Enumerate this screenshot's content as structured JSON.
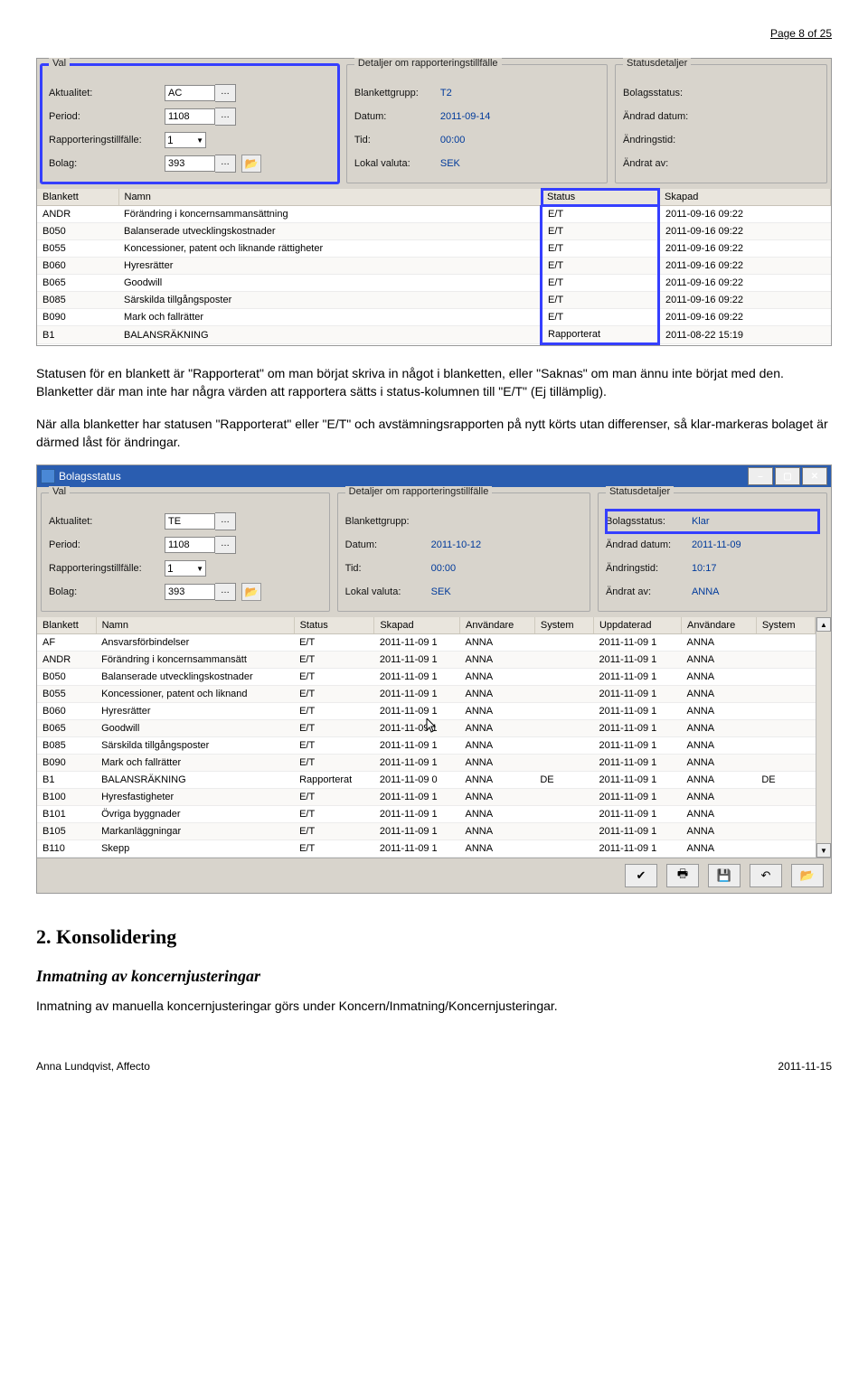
{
  "page_header": "Page 8 of 25",
  "para1": "Statusen för en blankett är \"Rapporterat\" om man börjat skriva in något i blanketten, eller \"Saknas\" om man ännu inte börjat med den. Blanketter där man inte har några värden att rapportera sätts i status-kolumnen till \"E/T\" (Ej tillämplig).",
  "para2": "När alla blanketter har statusen \"Rapporterat\" eller \"E/T\" och avstämningsrapporten på nytt körts utan differenser, så klar-markeras bolaget är därmed låst för ändringar.",
  "app1": {
    "val": {
      "legend": "Val",
      "aktualitet_label": "Aktualitet:",
      "aktualitet_value": "AC",
      "period_label": "Period:",
      "period_value": "1108",
      "rapp_label": "Rapporteringstillfälle:",
      "rapp_value": "1",
      "bolag_label": "Bolag:",
      "bolag_value": "393"
    },
    "details": {
      "legend": "Detaljer om rapporteringstillfälle",
      "grupp_label": "Blankettgrupp:",
      "grupp_value": "T2",
      "datum_label": "Datum:",
      "datum_value": "2011-09-14",
      "tid_label": "Tid:",
      "tid_value": "00:00",
      "valuta_label": "Lokal valuta:",
      "valuta_value": "SEK"
    },
    "status": {
      "legend": "Statusdetaljer",
      "bolag_label": "Bolagsstatus:",
      "and_datum_label": "Ändrad datum:",
      "and_tid_label": "Ändringstid:",
      "and_av_label": "Ändrat av:"
    },
    "cols": {
      "c1": "Blankett",
      "c2": "Namn",
      "c3": "Status",
      "c4": "Skapad"
    },
    "rows": [
      {
        "c1": "ANDR",
        "c2": "Förändring i koncernsammansättning",
        "c3": "E/T",
        "c4": "2011-09-16 09:22"
      },
      {
        "c1": "B050",
        "c2": "Balanserade utvecklingskostnader",
        "c3": "E/T",
        "c4": "2011-09-16 09:22"
      },
      {
        "c1": "B055",
        "c2": "Koncessioner, patent och liknande rättigheter",
        "c3": "E/T",
        "c4": "2011-09-16 09:22"
      },
      {
        "c1": "B060",
        "c2": "Hyresrätter",
        "c3": "E/T",
        "c4": "2011-09-16 09:22"
      },
      {
        "c1": "B065",
        "c2": "Goodwill",
        "c3": "E/T",
        "c4": "2011-09-16 09:22"
      },
      {
        "c1": "B085",
        "c2": "Särskilda tillgångsposter",
        "c3": "E/T",
        "c4": "2011-09-16 09:22"
      },
      {
        "c1": "B090",
        "c2": "Mark och fallrätter",
        "c3": "E/T",
        "c4": "2011-09-16 09:22"
      },
      {
        "c1": "B1",
        "c2": "BALANSRÄKNING",
        "c3": "Rapporterat",
        "c4": "2011-08-22 15:19"
      }
    ]
  },
  "app2": {
    "title": "Bolagsstatus",
    "val": {
      "legend": "Val",
      "aktualitet_label": "Aktualitet:",
      "aktualitet_value": "TE",
      "period_label": "Period:",
      "period_value": "1108",
      "rapp_label": "Rapporteringstillfälle:",
      "rapp_value": "1",
      "bolag_label": "Bolag:",
      "bolag_value": "393"
    },
    "details": {
      "legend": "Detaljer om rapporteringstillfälle",
      "grupp_label": "Blankettgrupp:",
      "grupp_value": "",
      "datum_label": "Datum:",
      "datum_value": "2011-10-12",
      "tid_label": "Tid:",
      "tid_value": "00:00",
      "valuta_label": "Lokal valuta:",
      "valuta_value": "SEK"
    },
    "status": {
      "legend": "Statusdetaljer",
      "bolag_label": "Bolagsstatus:",
      "bolag_value": "Klar",
      "and_datum_label": "Ändrad datum:",
      "and_datum_value": "2011-11-09",
      "and_tid_label": "Ändringstid:",
      "and_tid_value": "10:17",
      "and_av_label": "Ändrat av:",
      "and_av_value": "ANNA"
    },
    "cols": {
      "c1": "Blankett",
      "c2": "Namn",
      "c3": "Status",
      "c4": "Skapad",
      "c5": "Användare",
      "c6": "System",
      "c7": "Uppdaterad",
      "c8": "Användare",
      "c9": "System"
    },
    "rows": [
      {
        "c1": "AF",
        "c2": "Ansvarsförbindelser",
        "c3": "E/T",
        "c4": "2011-11-09 1",
        "c5": "ANNA",
        "c6": "",
        "c7": "2011-11-09 1",
        "c8": "ANNA",
        "c9": ""
      },
      {
        "c1": "ANDR",
        "c2": "Förändring i koncernsammansätt",
        "c3": "E/T",
        "c4": "2011-11-09 1",
        "c5": "ANNA",
        "c6": "",
        "c7": "2011-11-09 1",
        "c8": "ANNA",
        "c9": ""
      },
      {
        "c1": "B050",
        "c2": "Balanserade utvecklingskostnader",
        "c3": "E/T",
        "c4": "2011-11-09 1",
        "c5": "ANNA",
        "c6": "",
        "c7": "2011-11-09 1",
        "c8": "ANNA",
        "c9": ""
      },
      {
        "c1": "B055",
        "c2": "Koncessioner, patent och liknand",
        "c3": "E/T",
        "c4": "2011-11-09 1",
        "c5": "ANNA",
        "c6": "",
        "c7": "2011-11-09 1",
        "c8": "ANNA",
        "c9": ""
      },
      {
        "c1": "B060",
        "c2": "Hyresrätter",
        "c3": "E/T",
        "c4": "2011-11-09 1",
        "c5": "ANNA",
        "c6": "",
        "c7": "2011-11-09 1",
        "c8": "ANNA",
        "c9": ""
      },
      {
        "c1": "B065",
        "c2": "Goodwill",
        "c3": "E/T",
        "c4": "2011-11-09 1",
        "c5": "ANNA",
        "c6": "",
        "c7": "2011-11-09 1",
        "c8": "ANNA",
        "c9": ""
      },
      {
        "c1": "B085",
        "c2": "Särskilda tillgångsposter",
        "c3": "E/T",
        "c4": "2011-11-09 1",
        "c5": "ANNA",
        "c6": "",
        "c7": "2011-11-09 1",
        "c8": "ANNA",
        "c9": ""
      },
      {
        "c1": "B090",
        "c2": "Mark och fallrätter",
        "c3": "E/T",
        "c4": "2011-11-09 1",
        "c5": "ANNA",
        "c6": "",
        "c7": "2011-11-09 1",
        "c8": "ANNA",
        "c9": ""
      },
      {
        "c1": "B1",
        "c2": "BALANSRÄKNING",
        "c3": "Rapporterat",
        "c4": "2011-11-09 0",
        "c5": "ANNA",
        "c6": "DE",
        "c7": "2011-11-09 1",
        "c8": "ANNA",
        "c9": "DE"
      },
      {
        "c1": "B100",
        "c2": "Hyresfastigheter",
        "c3": "E/T",
        "c4": "2011-11-09 1",
        "c5": "ANNA",
        "c6": "",
        "c7": "2011-11-09 1",
        "c8": "ANNA",
        "c9": ""
      },
      {
        "c1": "B101",
        "c2": "Övriga byggnader",
        "c3": "E/T",
        "c4": "2011-11-09 1",
        "c5": "ANNA",
        "c6": "",
        "c7": "2011-11-09 1",
        "c8": "ANNA",
        "c9": ""
      },
      {
        "c1": "B105",
        "c2": "Markanläggningar",
        "c3": "E/T",
        "c4": "2011-11-09 1",
        "c5": "ANNA",
        "c6": "",
        "c7": "2011-11-09 1",
        "c8": "ANNA",
        "c9": ""
      },
      {
        "c1": "B110",
        "c2": "Skepp",
        "c3": "E/T",
        "c4": "2011-11-09 1",
        "c5": "ANNA",
        "c6": "",
        "c7": "2011-11-09 1",
        "c8": "ANNA",
        "c9": ""
      }
    ]
  },
  "h2": "2. Konsolidering",
  "h3": "Inmatning av koncernjusteringar",
  "para3": "Inmatning av manuella koncernjusteringar görs under Koncern/Inmatning/Koncernjusteringar.",
  "footer_left": "Anna Lundqvist, Affecto",
  "footer_right": "2011-11-15"
}
